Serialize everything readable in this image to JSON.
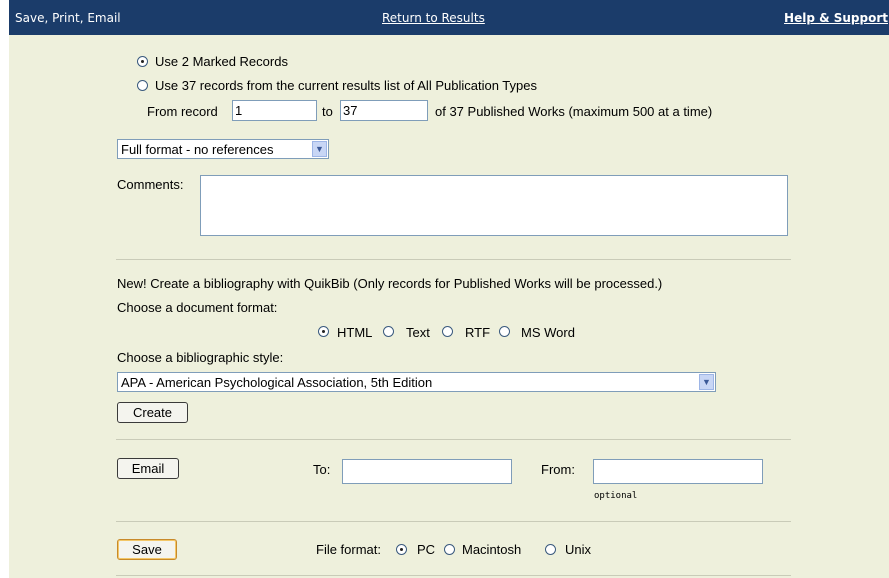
{
  "header": {
    "title": "Save, Print, Email",
    "return_link": "Return to Results",
    "help_link": "Help & Support"
  },
  "records": {
    "option_marked": "Use 2 Marked Records",
    "option_all": "Use 37 records from the current results list of All Publication Types",
    "from_label": "From record",
    "from_value": "1",
    "to_label": "to",
    "to_value": "37",
    "range_note": "of 37 Published Works (maximum 500 at a time)",
    "selected_option": "marked"
  },
  "format": {
    "selected": "Full format - no references"
  },
  "comments": {
    "label": "Comments:",
    "value": ""
  },
  "bibliography": {
    "intro": "New! Create a bibliography with QuikBib (Only records for Published Works will be processed.)",
    "doc_format_label": "Choose a document format:",
    "doc_formats": [
      "HTML",
      "Text",
      "RTF",
      "MS Word"
    ],
    "doc_format_selected": "HTML",
    "style_label": "Choose a bibliographic style:",
    "style_selected": "APA - American Psychological Association, 5th Edition",
    "create_button": "Create"
  },
  "email": {
    "button": "Email",
    "to_label": "To:",
    "to_value": "",
    "from_label": "From:",
    "from_value": "",
    "from_hint": "optional"
  },
  "save": {
    "button": "Save",
    "file_format_label": "File format:",
    "options": [
      "PC",
      "Macintosh",
      "Unix"
    ],
    "selected": "PC"
  }
}
